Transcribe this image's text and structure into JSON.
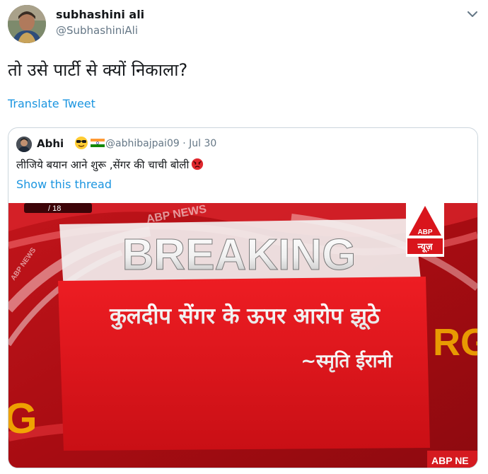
{
  "tweet": {
    "author_name": "subhashini ali",
    "author_handle": "@SubhashiniAli",
    "text": "तो उसे पार्टी से क्यों निकाला?",
    "translate_label": "Translate Tweet"
  },
  "quoted": {
    "author_name": "Abhi",
    "author_handle": "@abhibajpai09",
    "separator": "·",
    "date": "Jul 30",
    "text": "लीजिये बयान आने शुरू ,सेंगर की चाची बोली",
    "show_thread_label": "Show this thread",
    "emojis": [
      "sunglasses-face",
      "india-flag",
      "angry-face"
    ]
  },
  "media": {
    "breaking": "BREAKING",
    "headline": "कुलदीप सेंगर के ऊपर आरोप झूठे",
    "attribution": "~स्मृति ईरानी",
    "abp_logo": "ABP",
    "abp_hindi": "न्यूज़",
    "abp_news_corner": "ABP NE",
    "abp_news_top": "ABP NEWS",
    "abp_news_left": "ABP NEWS",
    "top_left_fragment": "/ 18",
    "letter_left": "G",
    "letter_right": "RG"
  },
  "colors": {
    "link": "#1b95e0",
    "name": "#14171a",
    "secondary": "#657786",
    "border": "#ccd6dd",
    "breaking_red": "#d91016"
  }
}
